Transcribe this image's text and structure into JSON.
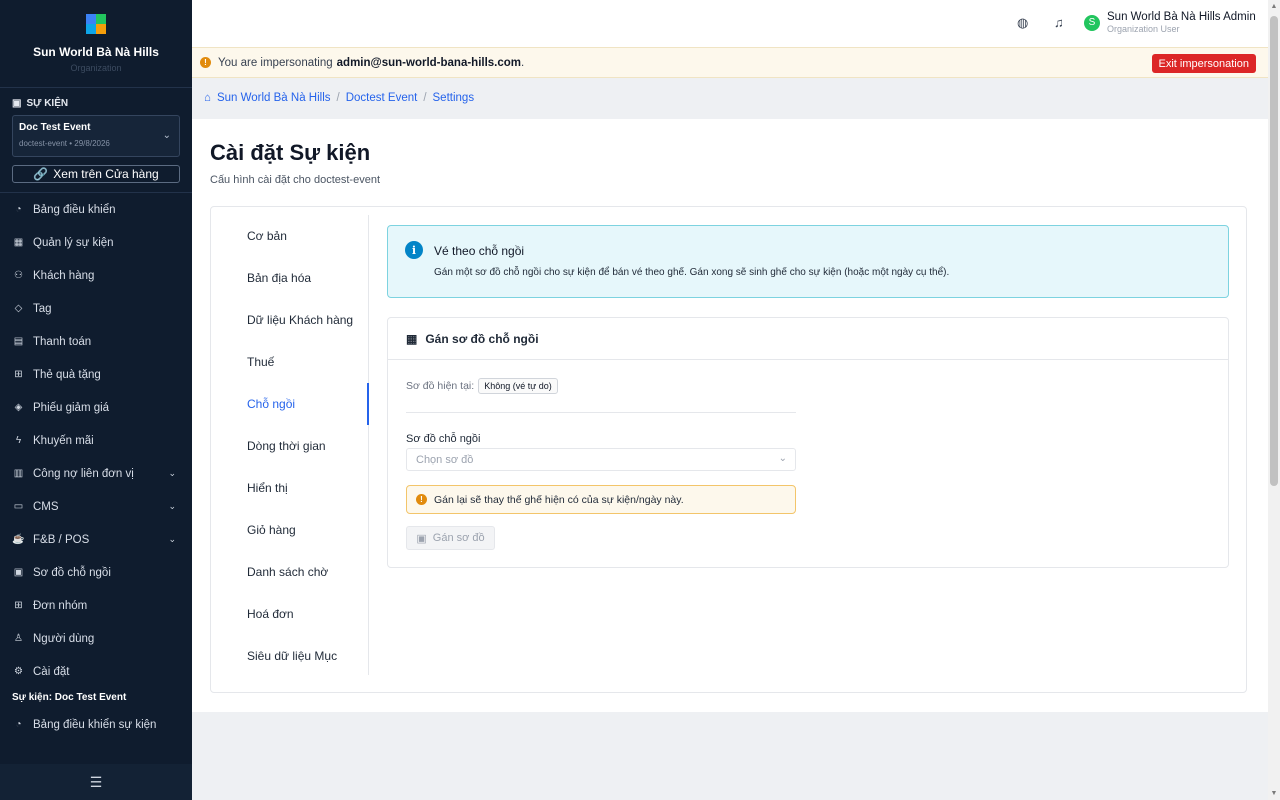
{
  "brand": {
    "name": "Sun World Bà Nà Hills",
    "sub": "Organization"
  },
  "event_section": {
    "header": "SỰ KIỆN",
    "event_name": "Doc Test Event",
    "event_meta": "doctest-event • 29/8/2026",
    "store_button": "Xem trên Cửa hàng"
  },
  "nav": [
    {
      "label": "Bảng điều khiển",
      "icon": "gauge-icon"
    },
    {
      "label": "Quản lý sự kiện",
      "icon": "calendar-icon"
    },
    {
      "label": "Khách hàng",
      "icon": "users-icon"
    },
    {
      "label": "Tag",
      "icon": "tag-icon"
    },
    {
      "label": "Thanh toán",
      "icon": "receipt-icon"
    },
    {
      "label": "Thẻ quà tặng",
      "icon": "gift-icon"
    },
    {
      "label": "Phiếu giảm giá",
      "icon": "coupon-icon"
    },
    {
      "label": "Khuyến mãi",
      "icon": "bolt-icon"
    },
    {
      "label": "Công nợ liên đơn vị",
      "icon": "ledger-icon"
    },
    {
      "label": "CMS",
      "icon": "document-icon"
    },
    {
      "label": "F&B / POS",
      "icon": "coffee-icon"
    },
    {
      "label": "Sơ đồ chỗ ngồi",
      "icon": "layout-icon"
    },
    {
      "label": "Đơn nhóm",
      "icon": "grid-icon"
    },
    {
      "label": "Người dùng",
      "icon": "user-icon"
    },
    {
      "label": "Cài đặt",
      "icon": "gear-icon"
    }
  ],
  "event_nav": {
    "group_label": "Sự kiện: Doc Test Event",
    "dashboard": "Bảng điều khiển sự kiện"
  },
  "user": {
    "name": "Sun World Bà Nà Hills Admin",
    "role": "Organization User",
    "initial": "S"
  },
  "impersonation": {
    "prefix": "You are impersonating",
    "email": "admin@sun-world-bana-hills.com",
    "suffix": ".",
    "exit": "Exit impersonation"
  },
  "breadcrumb": [
    "Sun World Bà Nà Hills",
    "Doctest Event",
    "Settings"
  ],
  "page": {
    "title": "Cài đặt Sự kiện",
    "subtitle": "Cấu hình cài đặt cho doctest-event"
  },
  "tabs": [
    "Cơ bản",
    "Bản địa hóa",
    "Dữ liệu Khách hàng",
    "Thuế",
    "Chỗ ngồi",
    "Dòng thời gian",
    "Hiển thị",
    "Giỏ hàng",
    "Danh sách chờ",
    "Hoá đơn",
    "Siêu dữ liệu Mục"
  ],
  "active_tab": "Chỗ ngồi",
  "info": {
    "title": "Vé theo chỗ ngồi",
    "text": "Gán một sơ đồ chỗ ngồi cho sự kiện để bán vé theo ghế. Gán xong sẽ sinh ghế cho sự kiện (hoặc một ngày cụ thể)."
  },
  "assign": {
    "title": "Gán sơ đồ chỗ ngồi",
    "current_label": "Sơ đồ hiện tại:",
    "current_value": "Không (vé tự do)",
    "field_label": "Sơ đồ chỗ ngồi",
    "select_placeholder": "Chọn sơ đồ",
    "warning": "Gán lại sẽ thay thế ghế hiện có của sự kiện/ngày này.",
    "button": "Gán sơ đồ"
  },
  "colors": {
    "sidebar": "#0f1c2e",
    "accent": "#2563eb",
    "danger": "#dc2626",
    "warning": "#e18b0d",
    "info": "#0284c7"
  }
}
